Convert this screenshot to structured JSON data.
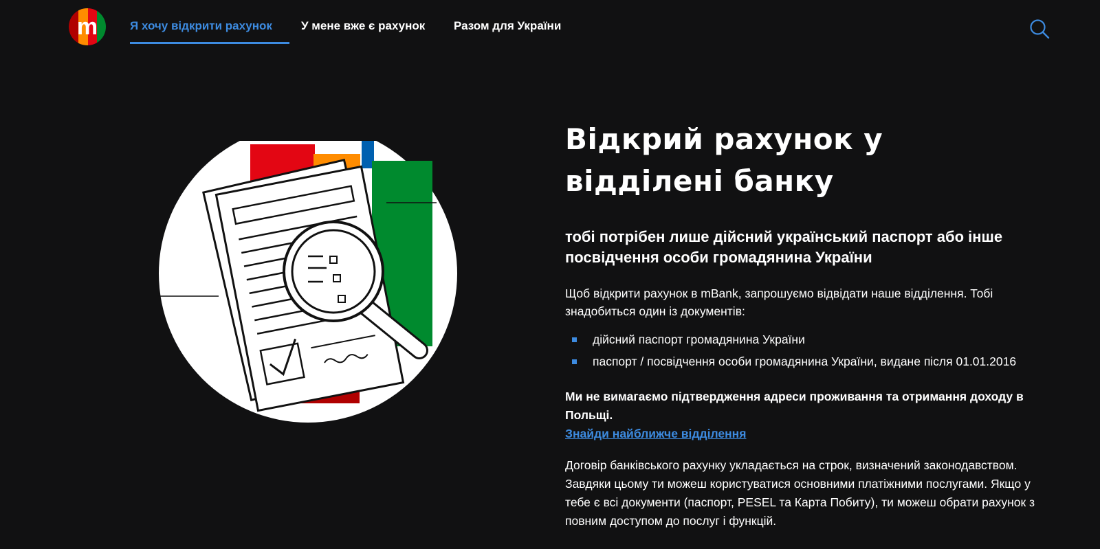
{
  "nav": {
    "logo_letter": "m",
    "links": [
      {
        "label": "Я хочу відкрити рахунок"
      },
      {
        "label": "У мене вже є рахунок"
      },
      {
        "label": "Разом для України"
      }
    ],
    "active_index": 0
  },
  "main": {
    "heading": "Відкрий рахунок у відділені банку",
    "subheading": "тобі потрібен лише дійсний український паспорт або інше посвідчення особи громадянина України",
    "intro": "Щоб відкрити рахунок в mBank, запрошуємо відвідати наше відділення. Тобі знадобиться один із документів:",
    "documents": [
      "дійсний паспорт громадянина України",
      "паспорт / посвідчення особи громадянина України, видане після 01.01.2016"
    ],
    "notice": "Ми не вимагаємо підтвердження адреси проживання та отримання доходу в Польщі.",
    "branch_link": "Знайди найближче відділення",
    "contract_text": "Договір банківського рахунку укладається на строк, визначений законодавством. Завдяки цьому ти можеш користуватися основними платіжними послугами. Якщо у тебе є всі документи (паспорт, PESEL та Карта Побиту), ти можеш обрати рахунок з повним доступом до послуг і функцій."
  },
  "colors": {
    "accent": "#3d8be0",
    "background": "#111112",
    "logo_red": "#e30613",
    "logo_orange": "#ff8c00",
    "logo_green": "#008a2e"
  },
  "icons": {
    "search": "search-icon",
    "bullet": "square-bullet-icon"
  }
}
